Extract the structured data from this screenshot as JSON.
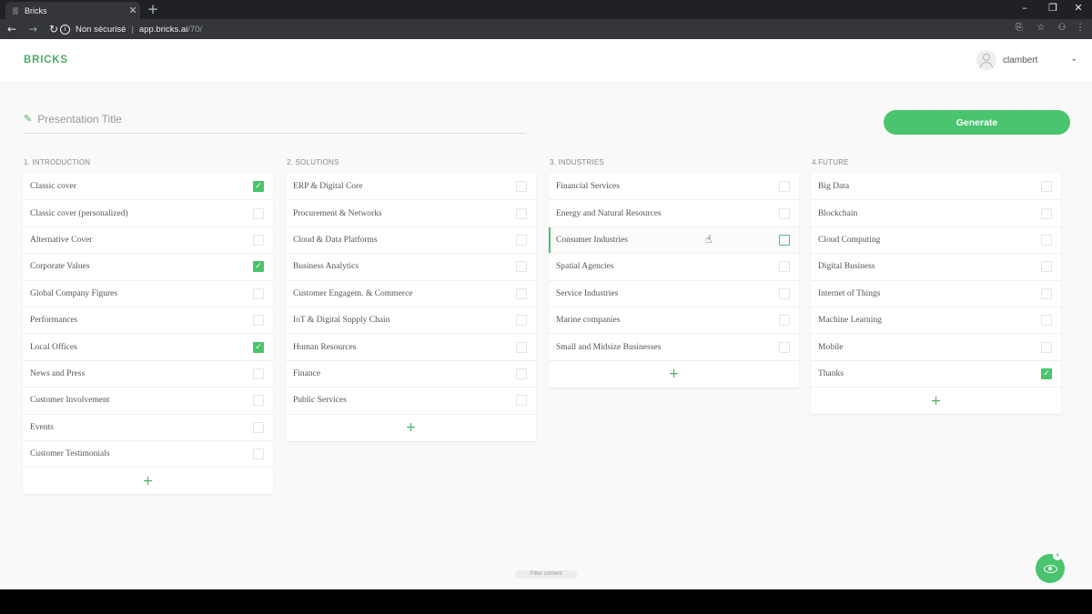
{
  "browser": {
    "tab_title": "Bricks",
    "tab_close": "✕",
    "new_tab": "+",
    "security_label": "Non sécurisé",
    "url_host": "app.bricks.ai",
    "url_path": "/70/",
    "win_minimize": "–",
    "win_restore": "❐",
    "win_close": "✕"
  },
  "app": {
    "logo": "BRICKS",
    "username": "clambert",
    "presentation_title_placeholder": "Presentation Title",
    "generate_label": "Generate",
    "filter_label": "Filter content",
    "fab_badge": "4",
    "accent_color": "#4ac46e"
  },
  "columns": [
    {
      "heading": "1. INTRODUCTION",
      "items": [
        {
          "label": "Classic cover",
          "checked": true
        },
        {
          "label": "Classic cover (personalized)",
          "checked": false
        },
        {
          "label": "Alternative Cover",
          "checked": false
        },
        {
          "label": "Corporate Values",
          "checked": true
        },
        {
          "label": "Global Company Figures",
          "checked": false
        },
        {
          "label": "Performances",
          "checked": false
        },
        {
          "label": "Local Offices",
          "checked": true
        },
        {
          "label": "News and Press",
          "checked": false
        },
        {
          "label": "Customer Involvement",
          "checked": false
        },
        {
          "label": "Events",
          "checked": false
        },
        {
          "label": "Customer Testimonials",
          "checked": false
        }
      ]
    },
    {
      "heading": "2. SOLUTIONS",
      "items": [
        {
          "label": "ERP & Digital Core",
          "checked": false
        },
        {
          "label": "Procurement & Networks",
          "checked": false
        },
        {
          "label": "Cloud & Data Platforms",
          "checked": false
        },
        {
          "label": "Business Analytics",
          "checked": false
        },
        {
          "label": "Customer Engagem. & Commerce",
          "checked": false
        },
        {
          "label": "IoT & Digital Supply Chain",
          "checked": false
        },
        {
          "label": "Human Resources",
          "checked": false
        },
        {
          "label": "Finance",
          "checked": false
        },
        {
          "label": "Public Services",
          "checked": false
        }
      ]
    },
    {
      "heading": "3. INDUSTRIES",
      "items": [
        {
          "label": "Financial Services",
          "checked": false
        },
        {
          "label": "Energy and Natural Resources",
          "checked": false
        },
        {
          "label": "Consumer Industries",
          "checked": false,
          "hover": true
        },
        {
          "label": "Spatial Agencies",
          "checked": false
        },
        {
          "label": "Service Industries",
          "checked": false
        },
        {
          "label": "Marine companies",
          "checked": false
        },
        {
          "label": "Small and Midsize Businesses",
          "checked": false
        }
      ]
    },
    {
      "heading": "4.FUTURE",
      "items": [
        {
          "label": "Big Data",
          "checked": false
        },
        {
          "label": "Blockchain",
          "checked": false
        },
        {
          "label": "Cloud Computing",
          "checked": false
        },
        {
          "label": "Digital Business",
          "checked": false
        },
        {
          "label": "Internet of Things",
          "checked": false
        },
        {
          "label": "Machine Learning",
          "checked": false
        },
        {
          "label": "Mobile",
          "checked": false
        },
        {
          "label": "Thanks",
          "checked": true
        }
      ]
    }
  ]
}
